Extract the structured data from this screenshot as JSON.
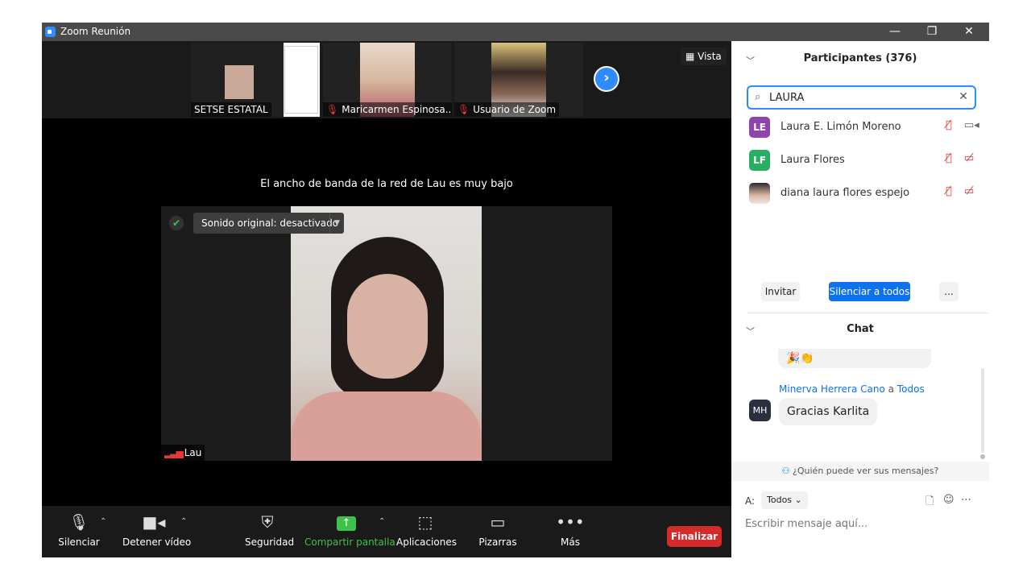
{
  "window": {
    "title": "Zoom Reunión",
    "minimize": "—",
    "restore": "❐",
    "close": "✕"
  },
  "gallery": {
    "thumbs": [
      {
        "name": "SETSE ESTATAL",
        "muted": false
      },
      {
        "name": "Maricarmen Espinosa...",
        "muted": true
      },
      {
        "name": "Usuario de Zoom",
        "muted": true
      }
    ],
    "next_icon": "chevron-right",
    "view_label": "Vista"
  },
  "main": {
    "notice": "El ancho de banda de la red de Lau es muy bajo",
    "audio_status": "Sonido original: desactivado",
    "active_speaker": "Lau"
  },
  "toolbar": {
    "mute": "Silenciar",
    "stop_video": "Detener vídeo",
    "security": "Seguridad",
    "share": "Compartir pantalla",
    "apps": "Aplicaciones",
    "whiteboards": "Pizarras",
    "more": "Más",
    "end": "Finalizar",
    "share_color": "#3ec14a",
    "end_color": "#d42a2a"
  },
  "participants": {
    "title": "Participantes (376)",
    "search_value": "LAURA",
    "list": [
      {
        "initials": "LE",
        "name": "Laura E. Limón Moreno",
        "color": "#8e44ad",
        "video_on": true
      },
      {
        "initials": "LF",
        "name": "Laura Flores",
        "color": "#27ae60",
        "video_on": false
      },
      {
        "initials": "",
        "name": "diana laura flores espejo",
        "color": "#555555",
        "video_on": false
      }
    ],
    "invite": "Invitar",
    "mute_all": "Silenciar a todos",
    "more": "..."
  },
  "chat": {
    "title": "Chat",
    "prev_message_emoji": "🎉👏",
    "sender": "Minerva Herrera Cano",
    "to_word": "a",
    "recipient": "Todos",
    "sender_initials": "MH",
    "message": "Gracias Karlita",
    "visibility": "¿Quién puede ver sus mensajes?",
    "to_label": "A:",
    "to_value": "Todos",
    "placeholder": "Escribir mensaje aquí..."
  }
}
